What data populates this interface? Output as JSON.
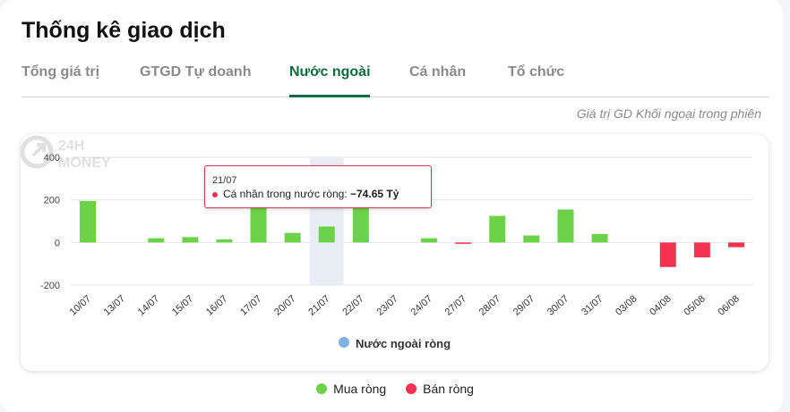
{
  "page": {
    "title": "Thống kê giao dịch",
    "tabs": [
      {
        "label": "Tổng giá trị"
      },
      {
        "label": "GTGD Tự doanh"
      },
      {
        "label": "Nước ngoài",
        "active": true
      },
      {
        "label": "Cá nhân"
      },
      {
        "label": "Tổ chức"
      }
    ],
    "subtitle": "Giá trị GD Khối ngoại trong phiên",
    "watermark": "24H MONEY"
  },
  "colors": {
    "buy": "#6cd24a",
    "sell": "#f2334f",
    "series": "#7fb0e6",
    "highlight": "#e9eef5"
  },
  "chart_data": {
    "type": "bar",
    "categories": [
      "10/07",
      "13/07",
      "14/07",
      "15/07",
      "16/07",
      "17/07",
      "20/07",
      "21/07",
      "22/07",
      "23/07",
      "24/07",
      "27/07",
      "28/07",
      "29/07",
      "30/07",
      "31/07",
      "03/08",
      "04/08",
      "05/08",
      "06/08"
    ],
    "values": [
      195,
      0,
      20,
      25,
      15,
      230,
      45,
      75,
      165,
      0,
      20,
      -5,
      125,
      33,
      155,
      40,
      0,
      -115,
      -70,
      -22
    ],
    "yticks": [
      400,
      200,
      0,
      -200
    ],
    "ylim": [
      -200,
      400
    ],
    "legend": "Nước ngoài ròng",
    "highlight_category": "21/07",
    "tooltip": {
      "date": "21/07",
      "label": "Cá nhân trong nước ròng:",
      "value": "−74.65 Tỷ"
    }
  },
  "legend_bottom": [
    {
      "label": "Mua ròng",
      "color": "#6cd24a"
    },
    {
      "label": "Bán ròng",
      "color": "#f2334f"
    }
  ]
}
